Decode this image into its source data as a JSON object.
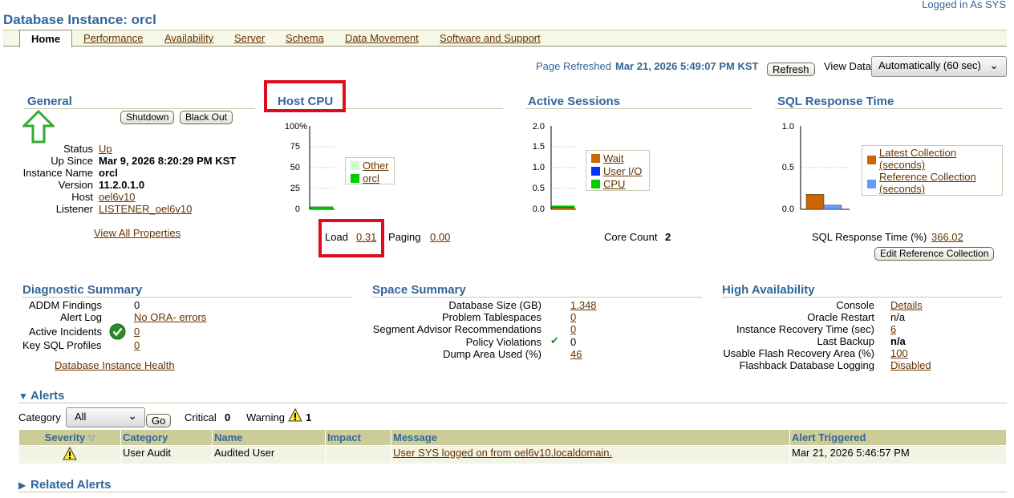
{
  "header": {
    "title": "Database Instance: orcl",
    "logged_in": "Logged in As SYS"
  },
  "tabs": [
    "Home",
    "Performance",
    "Availability",
    "Server",
    "Schema",
    "Data Movement",
    "Software and Support"
  ],
  "refresh": {
    "label": "Page Refreshed",
    "time": "Mar 21, 2026 5:49:07 PM KST",
    "button": "Refresh",
    "view_data_label": "View Data",
    "view_data_value": "Automatically (60 sec)"
  },
  "general": {
    "title": "General",
    "shutdown": "Shutdown",
    "blackout": "Black Out",
    "status_label": "Status",
    "status_value": "Up",
    "upsince_label": "Up Since",
    "upsince_value": "Mar 9, 2026 8:20:29 PM KST",
    "instance_label": "Instance Name",
    "instance_value": "orcl",
    "version_label": "Version",
    "version_value": "11.2.0.1.0",
    "host_label": "Host",
    "host_value": "oel6v10",
    "listener_label": "Listener",
    "listener_value": "LISTENER_oel6v10",
    "view_all": "View All Properties"
  },
  "host_cpu": {
    "title": "Host CPU",
    "ticks": [
      "100%",
      "75",
      "50",
      "25",
      "0"
    ],
    "legend": [
      "Other",
      "orcl"
    ],
    "load_label": "Load",
    "load_value": "0.31",
    "paging_label": "Paging",
    "paging_value": "0.00"
  },
  "active_sessions": {
    "title": "Active Sessions",
    "ticks": [
      "2.0",
      "1.5",
      "1.0",
      "0.5",
      "0.0"
    ],
    "legend": [
      "Wait",
      "User I/O",
      "CPU"
    ],
    "core_label": "Core Count",
    "core_value": "2"
  },
  "sql_response": {
    "title": "SQL Response Time",
    "ticks": [
      "1.0",
      "0.5",
      "0.0"
    ],
    "legend1": "Latest Collection (seconds)",
    "legend2": "Reference Collection (seconds)",
    "resp_label": "SQL Response Time (%)",
    "resp_value": "366.02",
    "edit_button": "Edit Reference Collection"
  },
  "diagnostic": {
    "title": "Diagnostic Summary",
    "addm_label": "ADDM Findings",
    "addm_value": "0",
    "alertlog_label": "Alert Log",
    "alertlog_value": "No ORA- errors",
    "incidents_label": "Active Incidents",
    "incidents_value": "0",
    "keysql_label": "Key SQL Profiles",
    "keysql_value": "0",
    "health_link": "Database Instance Health"
  },
  "space": {
    "title": "Space Summary",
    "dbsize_label": "Database Size (GB)",
    "dbsize_value": "1.348",
    "problem_label": "Problem Tablespaces",
    "problem_value": "0",
    "segment_label": "Segment Advisor Recommendations",
    "segment_value": "0",
    "policy_label": "Policy Violations",
    "policy_value": "0",
    "dump_label": "Dump Area Used (%)",
    "dump_value": "46"
  },
  "ha": {
    "title": "High Availability",
    "console_label": "Console",
    "console_value": "Details",
    "restart_label": "Oracle Restart",
    "restart_value": "n/a",
    "recovery_label": "Instance Recovery Time (sec)",
    "recovery_value": "6",
    "backup_label": "Last Backup",
    "backup_value": "n/a",
    "flash_label": "Usable Flash Recovery Area (%)",
    "flash_value": "100",
    "flashback_label": "Flashback Database Logging",
    "flashback_value": "Disabled"
  },
  "alerts": {
    "title": "Alerts",
    "category_label": "Category",
    "category_value": "All",
    "go": "Go",
    "critical_label": "Critical",
    "critical_value": "0",
    "warning_label": "Warning",
    "warning_value": "1",
    "columns": [
      "Severity",
      "Category",
      "Name",
      "Impact",
      "Message",
      "Alert Triggered"
    ],
    "row": {
      "category": "User Audit",
      "name": "Audited User",
      "impact": "",
      "message": "User SYS logged on from oel6v10.localdomain.",
      "triggered": "Mar 21, 2026 5:46:57 PM"
    }
  },
  "related": {
    "title": "Related Alerts"
  },
  "colors": {
    "brand": "#336699",
    "link": "#663300",
    "highlight": "#e00b1c",
    "cpu_other": "#ccffcc",
    "cpu_orcl": "#00cc00",
    "wait": "#cc6600",
    "userio": "#0033ff",
    "cpu": "#00cc00",
    "latest": "#cc6600",
    "reference": "#6699ff"
  },
  "chart_data": [
    {
      "type": "area",
      "title": "Host CPU",
      "ylim": [
        0,
        100
      ],
      "series": [
        {
          "name": "Other",
          "values": [
            0,
            0
          ]
        },
        {
          "name": "orcl",
          "values": [
            3,
            3
          ]
        }
      ]
    },
    {
      "type": "area",
      "title": "Active Sessions",
      "ylim": [
        0,
        2.0
      ],
      "series": [
        {
          "name": "Wait",
          "values": [
            0.05,
            0.05
          ]
        },
        {
          "name": "User I/O",
          "values": [
            0,
            0
          ]
        },
        {
          "name": "CPU",
          "values": [
            0.03,
            0.03
          ]
        }
      ]
    },
    {
      "type": "bar",
      "title": "SQL Response Time",
      "ylim": [
        0,
        1.0
      ],
      "categories": [
        "Latest Collection (seconds)",
        "Reference Collection (seconds)"
      ],
      "values": [
        0.18,
        0.05
      ]
    }
  ]
}
